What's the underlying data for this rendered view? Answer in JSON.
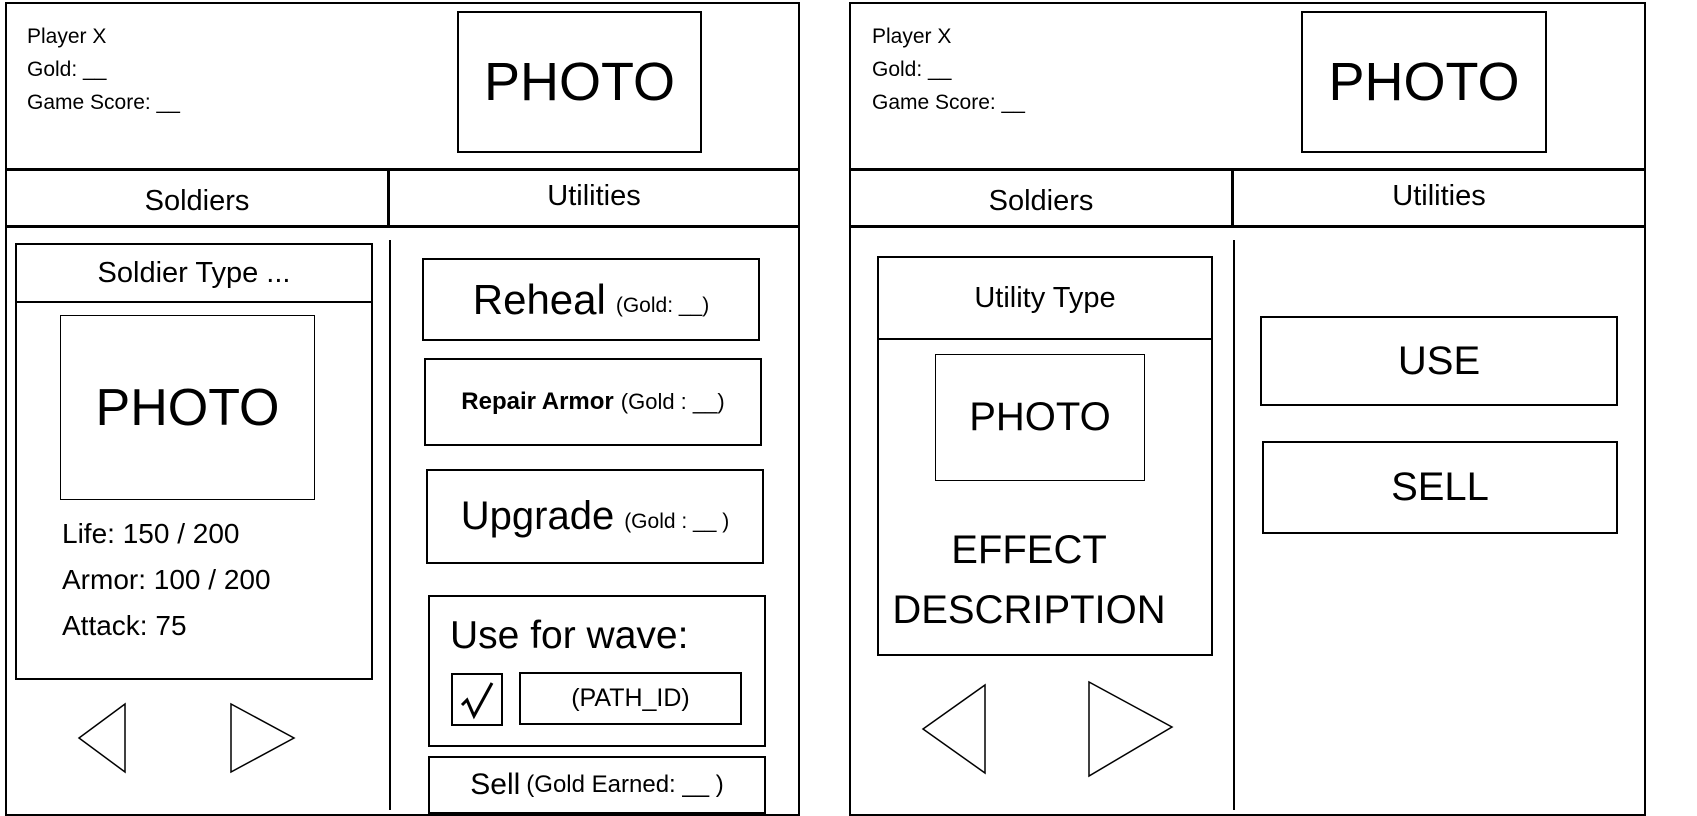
{
  "left": {
    "player": {
      "name": "Player X",
      "gold": "Gold: __",
      "score": "Game Score: __"
    },
    "header_photo": "PHOTO",
    "tabs": {
      "soldiers": "Soldiers",
      "utilities": "Utilities"
    },
    "card": {
      "type": "Soldier Type ...",
      "photo": "PHOTO",
      "life": "Life: 150 / 200",
      "armor": "Armor: 100 / 200",
      "attack": "Attack: 75"
    },
    "actions": {
      "reheal": {
        "label": "Reheal",
        "cost": "(Gold: __)"
      },
      "repair": {
        "label": "Repair Armor",
        "cost": "(Gold : __)"
      },
      "upgrade": {
        "label": "Upgrade",
        "cost": "(Gold : __ )"
      },
      "wave": {
        "label": "Use for wave:",
        "path_id": "(PATH_ID)",
        "checked": true
      },
      "sell": {
        "label": "Sell",
        "cost": "(Gold Earned: __ )"
      }
    },
    "nav": {
      "prev_icon": "triangle-left-icon",
      "next_icon": "triangle-right-icon"
    }
  },
  "right": {
    "player": {
      "name": "Player X",
      "gold": "Gold: __",
      "score": "Game Score: __"
    },
    "header_photo": "PHOTO",
    "tabs": {
      "soldiers": "Soldiers",
      "utilities": "Utilities"
    },
    "card": {
      "type": "Utility Type",
      "photo": "PHOTO",
      "effect_line1": "EFFECT",
      "effect_line2": "DESCRIPTION"
    },
    "buttons": {
      "use": "USE",
      "sell": "SELL"
    },
    "nav": {
      "prev_icon": "triangle-left-icon",
      "next_icon": "triangle-right-icon"
    }
  }
}
